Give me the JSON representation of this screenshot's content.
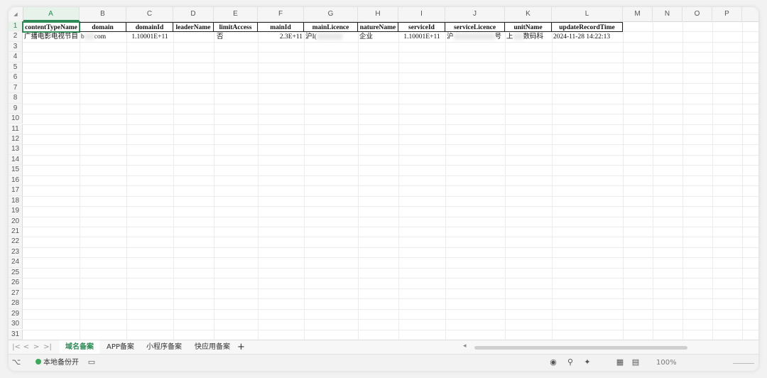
{
  "columns": [
    "A",
    "B",
    "C",
    "D",
    "E",
    "F",
    "G",
    "H",
    "I",
    "J",
    "K",
    "L",
    "M",
    "N",
    "O",
    "P"
  ],
  "rows": [
    "1",
    "2",
    "3",
    "4",
    "5",
    "6",
    "7",
    "8",
    "9",
    "10",
    "11",
    "12",
    "13",
    "14",
    "15",
    "16",
    "17",
    "18",
    "19",
    "20",
    "21",
    "22",
    "23",
    "24",
    "25",
    "26",
    "27",
    "28",
    "29",
    "30",
    "31"
  ],
  "headers": [
    "contentTypeName",
    "domain",
    "domainId",
    "leaderName",
    "limitAccess",
    "mainId",
    "mainLicence",
    "natureName",
    "serviceId",
    "serviceLicence",
    "unitName",
    "updateRecordTime"
  ],
  "row2": {
    "contentTypeName": "广播电影电视节目",
    "domain_prefix": "b",
    "domain_suffix": "com",
    "domainId": "1.10001E+11",
    "leaderName": "",
    "limitAccess": "否",
    "mainId": "2.3E+11",
    "mainLicence": "沪I(",
    "natureName": "企业",
    "serviceId": "1.10001E+11",
    "serviceLicence_prefix": "沪",
    "serviceLicence_suffix": "号",
    "unitName_prefix": "上",
    "unitName_suffix": "数码科",
    "updateRecordTime": "2024-11-28 14:22:13"
  },
  "sheet_tabs": [
    "域名备案",
    "APP备案",
    "小程序备案",
    "快应用备案"
  ],
  "active_tab": "域名备案",
  "add_tab": "+",
  "nav": [
    "|<",
    "<",
    ">",
    ">|"
  ],
  "status": {
    "backup_label": "本地备份开",
    "zoom": "100%"
  },
  "colors": {
    "accent": "#2e8b57",
    "backup_dot": "#3aaa5a"
  }
}
